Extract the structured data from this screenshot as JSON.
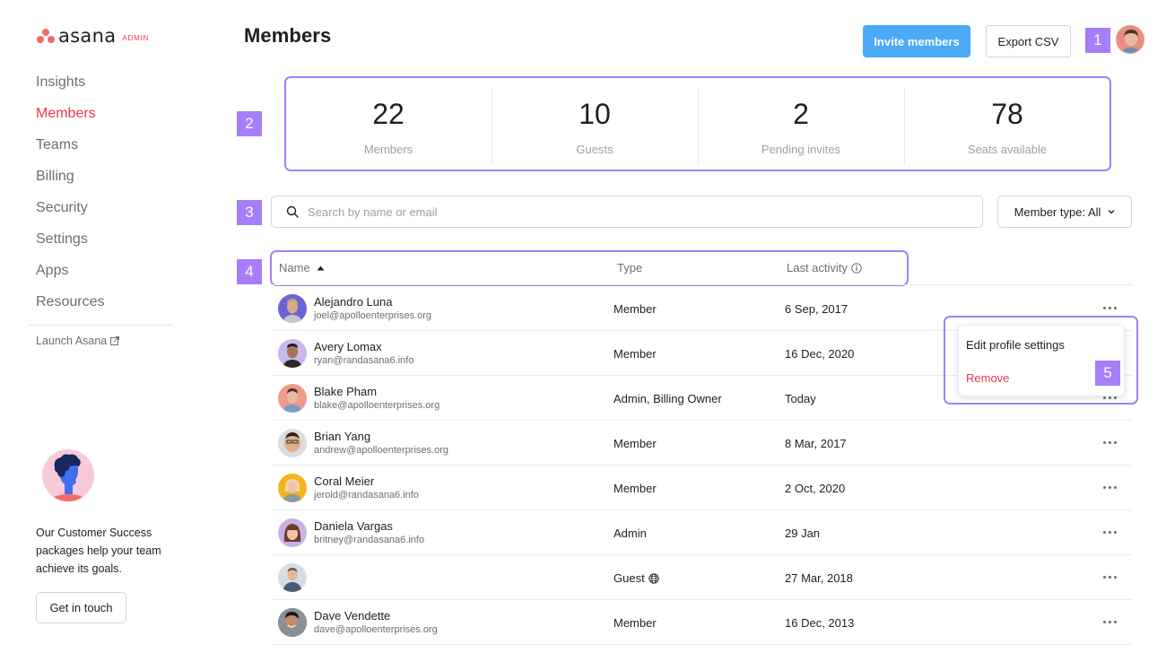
{
  "app": {
    "logo_text": "asana",
    "logo_badge": "ADMIN",
    "brand_color": "#f06a6a",
    "accent_color": "#e8384f"
  },
  "sidebar": {
    "items": [
      {
        "label": "Insights",
        "active": false
      },
      {
        "label": "Members",
        "active": true
      },
      {
        "label": "Teams",
        "active": false
      },
      {
        "label": "Billing",
        "active": false
      },
      {
        "label": "Security",
        "active": false
      },
      {
        "label": "Settings",
        "active": false
      },
      {
        "label": "Apps",
        "active": false
      },
      {
        "label": "Resources",
        "active": false
      }
    ],
    "launch_label": "Launch Asana",
    "promo_text": "Our Customer Success packages help your team achieve its goals.",
    "promo_button": "Get in touch"
  },
  "header": {
    "title": "Members",
    "invite_label": "Invite members",
    "export_label": "Export CSV"
  },
  "stats": [
    {
      "value": "22",
      "label": "Members"
    },
    {
      "value": "10",
      "label": "Guests"
    },
    {
      "value": "2",
      "label": "Pending invites"
    },
    {
      "value": "78",
      "label": "Seats available"
    }
  ],
  "search": {
    "placeholder": "Search by name or email",
    "value": ""
  },
  "filter": {
    "label": "Member type: All"
  },
  "table": {
    "columns": {
      "name": "Name",
      "type": "Type",
      "last_activity": "Last activity"
    },
    "rows": [
      {
        "name": "Alejandro Luna",
        "email": "joel@apolloenterprises.org",
        "type": "Member",
        "last_activity": "6 Sep, 2017",
        "avatar_bg": "#6a63d8"
      },
      {
        "name": "Avery Lomax",
        "email": "ryan@randasana6.info",
        "type": "Member",
        "last_activity": "16 Dec, 2020",
        "avatar_bg": "#c8b8f0"
      },
      {
        "name": "Blake Pham",
        "email": "blake@apolloenterprises.org",
        "type": "Admin, Billing Owner",
        "last_activity": "Today",
        "avatar_bg": "#f09a8c"
      },
      {
        "name": "Brian Yang",
        "email": "andrew@apolloenterprises.org",
        "type": "Member",
        "last_activity": "8 Mar, 2017",
        "avatar_bg": "#dcdcdc"
      },
      {
        "name": "Coral Meier",
        "email": "jerold@randasana6.info",
        "type": "Member",
        "last_activity": "2 Oct, 2020",
        "avatar_bg": "#f3b51c"
      },
      {
        "name": "Daniela Vargas",
        "email": "britney@randasana6.info",
        "type": "Admin",
        "last_activity": "29 Jan",
        "avatar_bg": "#c9b0e6"
      },
      {
        "name": "",
        "email": "",
        "type": "Guest",
        "last_activity": "27 Mar, 2018",
        "avatar_bg": "#d6dde3",
        "guest_icon": true
      },
      {
        "name": "Dave Vendette",
        "email": "dave@apolloenterprises.org",
        "type": "Member",
        "last_activity": "16 Dec, 2013",
        "avatar_bg": "#5a4a3e"
      }
    ]
  },
  "row_menu": {
    "edit_label": "Edit profile settings",
    "remove_label": "Remove"
  },
  "annotations": [
    "1",
    "2",
    "3",
    "4",
    "5"
  ]
}
